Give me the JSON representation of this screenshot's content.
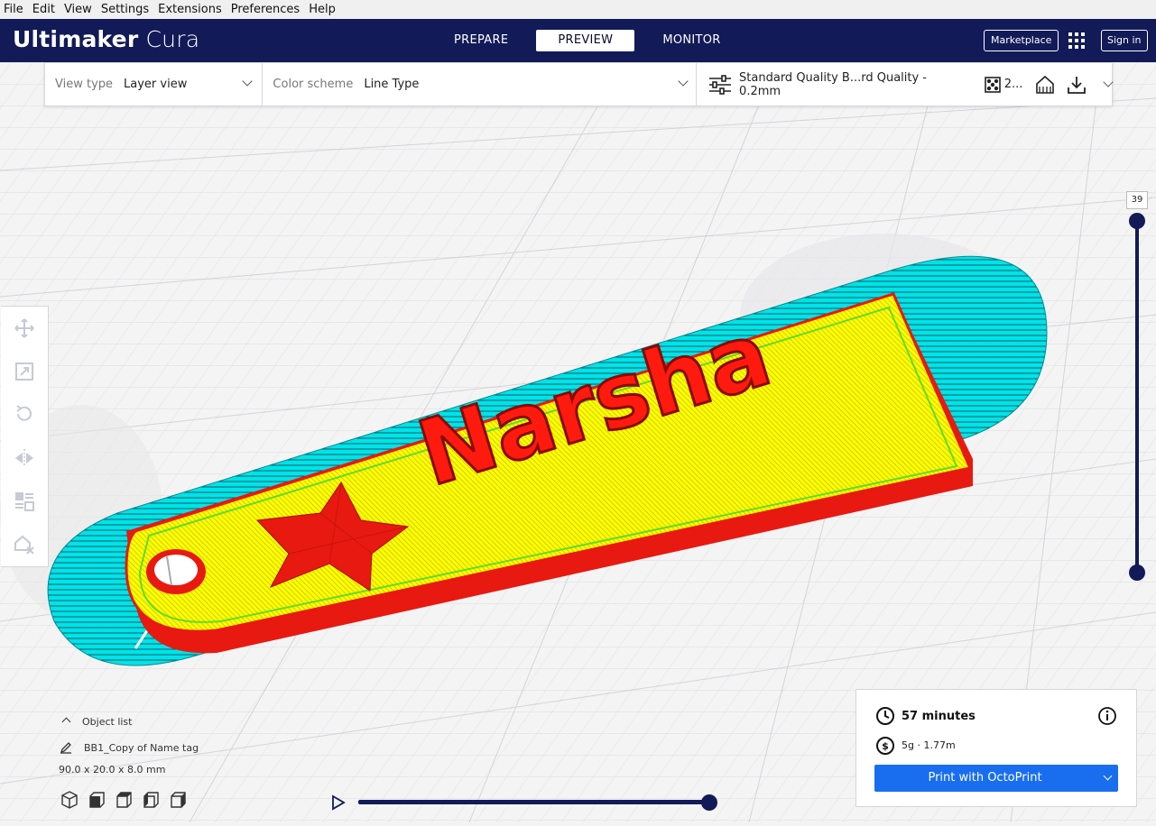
{
  "menu": [
    "File",
    "Edit",
    "View",
    "Settings",
    "Extensions",
    "Preferences",
    "Help"
  ],
  "app": {
    "brand_bold": "Ultimaker",
    "brand_light": "Cura"
  },
  "stages": [
    {
      "label": "PREPARE",
      "active": false
    },
    {
      "label": "PREVIEW",
      "active": true
    },
    {
      "label": "MONITOR",
      "active": false
    }
  ],
  "header": {
    "marketplace": "Marketplace",
    "signin": "Sign in"
  },
  "viewbar": {
    "view_type_label": "View type",
    "view_type_value": "Layer view",
    "color_scheme_label": "Color scheme",
    "color_scheme_value": "Line Type",
    "profile": "Standard Quality B...rd Quality - 0.2mm",
    "infill": "2..."
  },
  "model": {
    "text": "Narsha"
  },
  "layer_slider": {
    "current_layer": "39"
  },
  "object_list": {
    "title": "Object list",
    "object_name": "BB1_Copy of Name tag",
    "dimensions": "90.0 x 20.0 x 8.0 mm"
  },
  "print": {
    "time": "57 minutes",
    "material": "5g · 1.77m",
    "button": "Print with OctoPrint"
  },
  "colors": {
    "header_bg": "#121a57",
    "print_button": "#196ef0",
    "skirt": "#00e5ea",
    "top_skin": "#ffff00",
    "wall": "#ff1a12",
    "inner_wall": "#33d633"
  }
}
